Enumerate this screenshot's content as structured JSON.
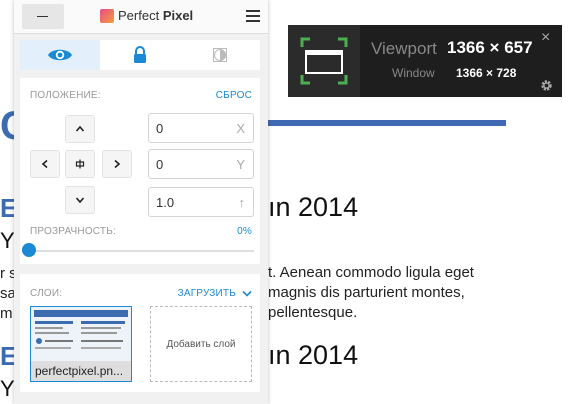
{
  "background": {
    "big_letter": "C",
    "headings": [
      "ın 2014",
      "ın 2014"
    ],
    "paragraph": [
      "t. Aenean commodo ligula eget",
      "magnis dis parturient montes,",
      "pellentesque."
    ],
    "left_chars": {
      "e1": "E",
      "y1": "Y",
      "r": "r s",
      "s": "sa",
      "m": "m",
      "e2": "E",
      "y2": "Y"
    }
  },
  "panel": {
    "title_plain": "Perfect",
    "title_bold": "Pixel",
    "tabs": [
      {
        "name": "eye"
      },
      {
        "name": "lock"
      },
      {
        "name": "invert"
      }
    ],
    "position": {
      "label": "ПОЛОЖЕНИЕ:",
      "reset": "СБРОС",
      "x": {
        "value": "0",
        "suffix": "X"
      },
      "y": {
        "value": "0",
        "suffix": "Y"
      },
      "scale": {
        "value": "1.0",
        "suffix": "↑"
      }
    },
    "opacity": {
      "label": "ПРОЗРАЧНОСТЬ:",
      "value": "0%",
      "level": 0
    },
    "layers": {
      "label": "СЛОИ:",
      "load": "ЗАГРУЗИТЬ",
      "items": [
        {
          "filename": "perfectpixel.pn..."
        }
      ],
      "add_label": "Добавить слой"
    },
    "accent": "#1a8ad4"
  },
  "viewport": {
    "label": "Viewport",
    "value": "1366 × 657",
    "window_label": "Window",
    "window_value": "1366 × 728",
    "close": "×"
  }
}
